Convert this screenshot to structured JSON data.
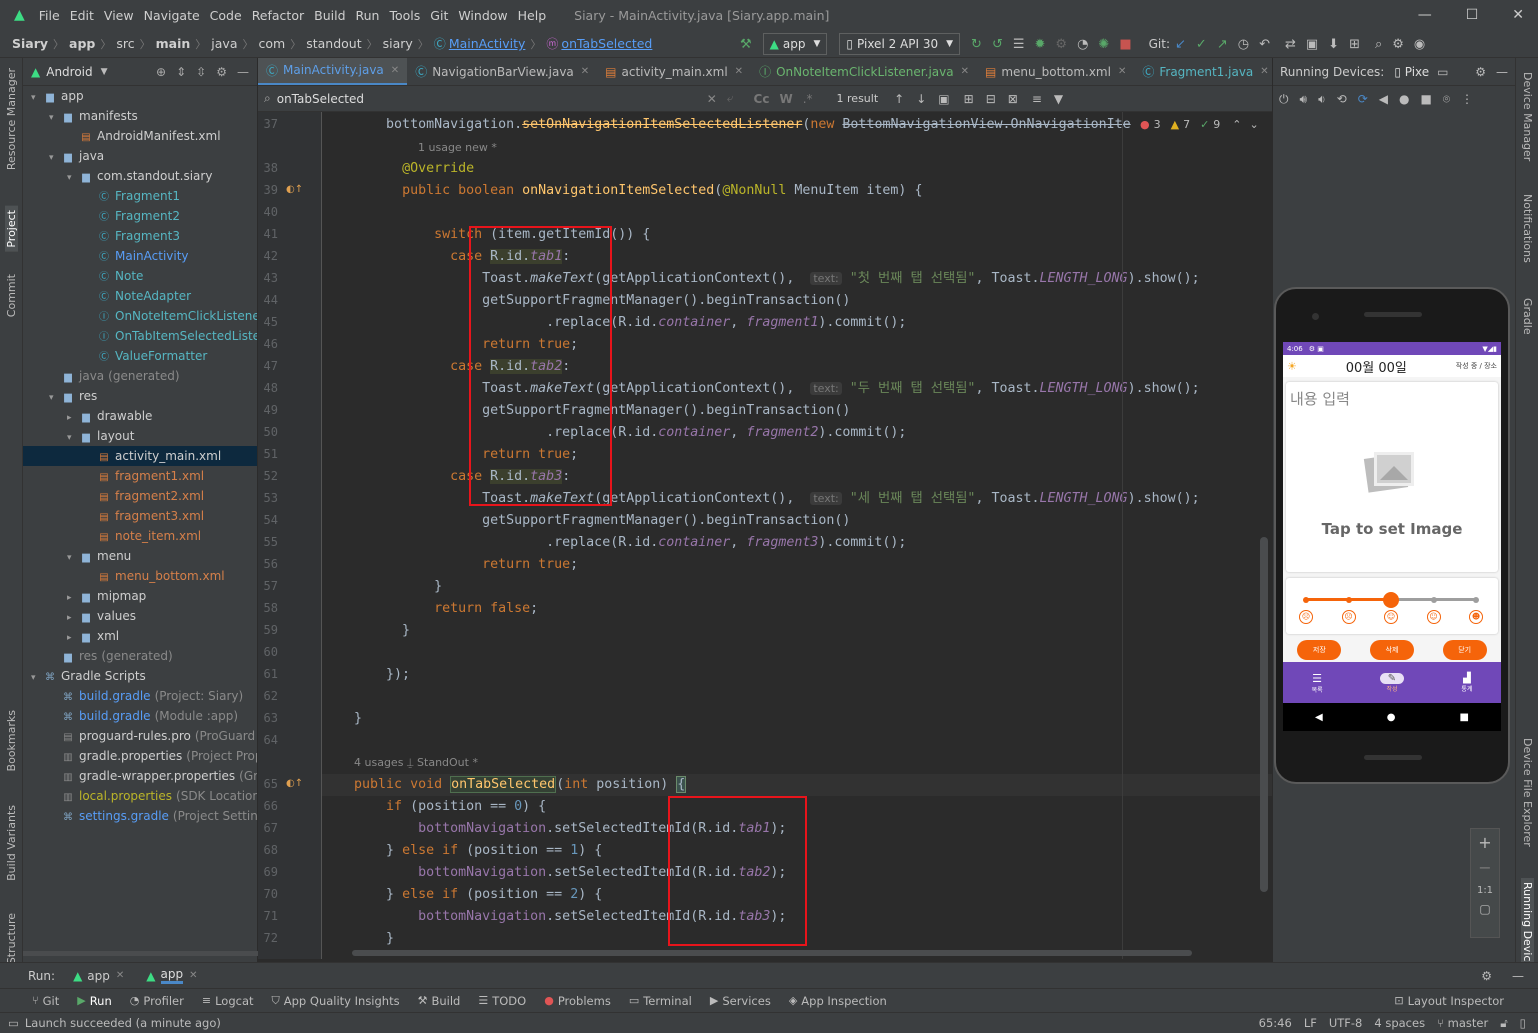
{
  "titlebar": {
    "menu": [
      "File",
      "Edit",
      "View",
      "Navigate",
      "Code",
      "Refactor",
      "Build",
      "Run",
      "Tools",
      "Git",
      "Window",
      "Help"
    ],
    "title": "Siary - MainActivity.java [Siary.app.main]"
  },
  "breadcrumb": [
    "Siary",
    "app",
    "src",
    "main",
    "java",
    "com",
    "standout",
    "siary",
    "MainActivity",
    "onTabSelected"
  ],
  "toolbar": {
    "run_config": "app",
    "device": "Pixel 2 API 30",
    "git_label": "Git:"
  },
  "project": {
    "view_label": "Android",
    "items": [
      {
        "label": "app",
        "level": 0,
        "icon": "folder"
      },
      {
        "label": "manifests",
        "level": 1,
        "icon": "folder"
      },
      {
        "label": "AndroidManifest.xml",
        "level": 2,
        "icon": "manifest"
      },
      {
        "label": "java",
        "level": 1,
        "icon": "folder"
      },
      {
        "label": "com.standout.siary",
        "level": 2,
        "icon": "package"
      },
      {
        "label": "Fragment1",
        "level": 3,
        "icon": "class"
      },
      {
        "label": "Fragment2",
        "level": 3,
        "icon": "class"
      },
      {
        "label": "Fragment3",
        "level": 3,
        "icon": "class"
      },
      {
        "label": "MainActivity",
        "level": 3,
        "icon": "class"
      },
      {
        "label": "Note",
        "level": 3,
        "icon": "class"
      },
      {
        "label": "NoteAdapter",
        "level": 3,
        "icon": "class"
      },
      {
        "label": "OnNoteItemClickListener",
        "level": 3,
        "icon": "interface"
      },
      {
        "label": "OnTabItemSelectedListene",
        "level": 3,
        "icon": "interface"
      },
      {
        "label": "ValueFormatter",
        "level": 3,
        "icon": "class"
      },
      {
        "label": "java",
        "suffix": "(generated)",
        "level": 1,
        "icon": "folder"
      },
      {
        "label": "res",
        "level": 1,
        "icon": "folder"
      },
      {
        "label": "drawable",
        "level": 2,
        "icon": "folder"
      },
      {
        "label": "layout",
        "level": 2,
        "icon": "folder"
      },
      {
        "label": "activity_main.xml",
        "level": 3,
        "icon": "xml"
      },
      {
        "label": "fragment1.xml",
        "level": 3,
        "icon": "xml"
      },
      {
        "label": "fragment2.xml",
        "level": 3,
        "icon": "xml"
      },
      {
        "label": "fragment3.xml",
        "level": 3,
        "icon": "xml"
      },
      {
        "label": "note_item.xml",
        "level": 3,
        "icon": "xml"
      },
      {
        "label": "menu",
        "level": 2,
        "icon": "folder"
      },
      {
        "label": "menu_bottom.xml",
        "level": 3,
        "icon": "xml"
      },
      {
        "label": "mipmap",
        "level": 2,
        "icon": "folder"
      },
      {
        "label": "values",
        "level": 2,
        "icon": "folder"
      },
      {
        "label": "xml",
        "level": 2,
        "icon": "folder"
      },
      {
        "label": "res",
        "suffix": "(generated)",
        "level": 1,
        "icon": "folder"
      },
      {
        "label": "Gradle Scripts",
        "level": 0,
        "icon": "gradle"
      },
      {
        "label": "build.gradle",
        "suffix": "(Project: Siary)",
        "level": 1,
        "icon": "gradle"
      },
      {
        "label": "build.gradle",
        "suffix": "(Module :app)",
        "level": 1,
        "icon": "gradle"
      },
      {
        "label": "proguard-rules.pro",
        "suffix": "(ProGuard Ru",
        "level": 1,
        "icon": "file"
      },
      {
        "label": "gradle.properties",
        "suffix": "(Project Proper",
        "level": 1,
        "icon": "props"
      },
      {
        "label": "gradle-wrapper.properties",
        "suffix": "(Gradl",
        "level": 1,
        "icon": "props"
      },
      {
        "label": "local.properties",
        "suffix": "(SDK Location)",
        "level": 1,
        "icon": "props"
      },
      {
        "label": "settings.gradle",
        "suffix": "(Project Settings)",
        "level": 1,
        "icon": "gradle"
      }
    ]
  },
  "tabs": [
    {
      "label": "MainActivity.java",
      "active": true
    },
    {
      "label": "NavigationBarView.java",
      "active": false
    },
    {
      "label": "activity_main.xml",
      "active": false
    },
    {
      "label": "OnNoteItemClickListener.java",
      "active": false
    },
    {
      "label": "menu_bottom.xml",
      "active": false
    },
    {
      "label": "Fragment1.java",
      "active": false
    }
  ],
  "search": {
    "query": "onTabSelected",
    "result_count": "1 result"
  },
  "inspections": {
    "errors": "3",
    "warnings": "7",
    "weak": "9"
  },
  "code": {
    "usages_1": "1 usage   new *",
    "usages_2": "4 usages",
    "author": "StandOut *",
    "toast_hint": "text:",
    "str_tab1": "\"첫 번째 탭 선택됨\"",
    "str_tab2": "\"두 번째 탭 선택됨\"",
    "str_tab3": "\"세 번째 탭 선택됨\""
  },
  "running_devices": {
    "title": "Running Devices:",
    "tab": "Pixe"
  },
  "phone": {
    "status_time": "4:06",
    "date": "00월 00일",
    "top_right": "작성 중 / 장소",
    "content_placeholder": "내용 입력",
    "image_hint": "Tap to set Image",
    "buttons": [
      "저장",
      "삭제",
      "닫기"
    ],
    "nav": [
      "목록",
      "작성",
      "통계"
    ],
    "mood_level_index": 2
  },
  "runbar": {
    "label": "Run:",
    "configs": [
      "app",
      "app"
    ]
  },
  "bottom_tools": [
    "Git",
    "Run",
    "Profiler",
    "Logcat",
    "App Quality Insights",
    "Build",
    "TODO",
    "Problems",
    "Terminal",
    "Services",
    "App Inspection"
  ],
  "layout_inspector": "Layout Inspector",
  "status": {
    "message": "Launch succeeded (a minute ago)",
    "position": "65:46",
    "line_sep": "LF",
    "encoding": "UTF-8",
    "indent": "4 spaces",
    "branch": "master"
  },
  "side_labels": {
    "left": [
      "Resource Manager",
      "Project",
      "Commit",
      "Bookmarks",
      "Build Variants",
      "Structure"
    ],
    "right": [
      "Device Manager",
      "Notifications",
      "Gradle",
      "Device File Explorer",
      "Running Devices"
    ]
  },
  "zoom": {
    "fit": "1:1"
  },
  "colors": {
    "accent": "#4a88c7",
    "phone_bar": "#7048b8",
    "phone_orange": "#f5640a",
    "highlight_box": "#e8141b"
  }
}
